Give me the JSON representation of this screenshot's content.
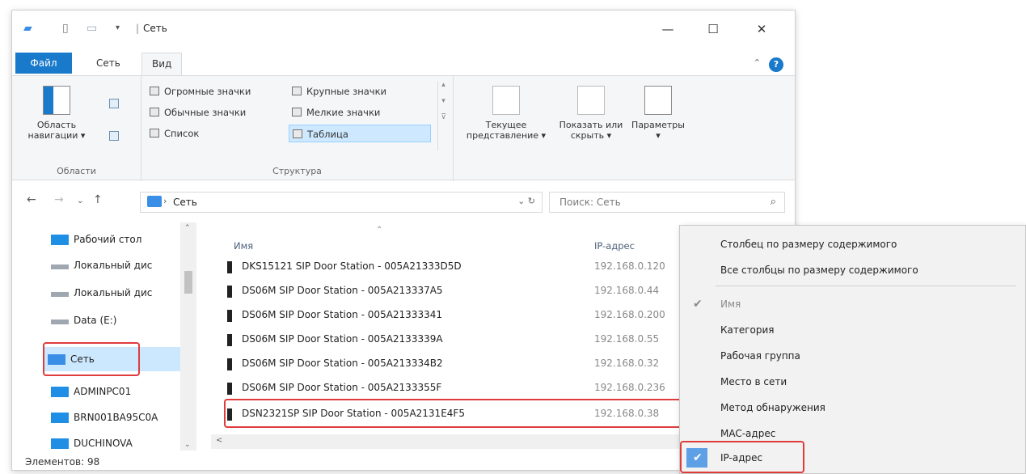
{
  "window": {
    "title": "Сеть",
    "min": "—",
    "max": "☐",
    "close": "✕"
  },
  "ribbon_tabs": {
    "file": "Файл",
    "network": "Сеть",
    "view": "Вид"
  },
  "ribbon": {
    "panes": {
      "nav_pane_label": "Область навигации ▾",
      "group_label": "Области"
    },
    "layout": {
      "items": [
        "Огромные значки",
        "Крупные значки",
        "Обычные значки",
        "Мелкие значки",
        "Список",
        "Таблица"
      ],
      "selected": "Таблица",
      "group_label": "Структура"
    },
    "current_view": {
      "current_label": "Текущее представление ▾",
      "show_hide_label": "Показать или скрыть ▾",
      "options_label": "Параметры ▾"
    }
  },
  "address": {
    "path": "Сеть",
    "search_placeholder": "Поиск: Сеть",
    "refresh_icon": "↻"
  },
  "nav_pane": {
    "items": [
      {
        "label": "Рабочий стол",
        "icon": "desktop-icon"
      },
      {
        "label": "Локальный дис",
        "icon": "drive-icon"
      },
      {
        "label": "Локальный дис",
        "icon": "drive-icon"
      },
      {
        "label": "Data (E:)",
        "icon": "drive-icon"
      },
      {
        "label": "Сеть",
        "icon": "network-icon",
        "selected": true
      },
      {
        "label": "ADMINPC01",
        "icon": "computer-icon"
      },
      {
        "label": "BRN001BA95C0A",
        "icon": "computer-icon"
      },
      {
        "label": "DUCHINOVA",
        "icon": "computer-icon"
      }
    ]
  },
  "file_list": {
    "columns": {
      "name": "Имя",
      "ip": "IP-адрес"
    },
    "rows": [
      {
        "name": "DKS15121 SIP Door Station - 005A21333D5D",
        "ip": "192.168.0.120"
      },
      {
        "name": "DS06M SIP Door Station - 005A213337A5",
        "ip": "192.168.0.44"
      },
      {
        "name": "DS06M SIP Door Station - 005A21333341",
        "ip": "192.168.0.200"
      },
      {
        "name": "DS06M SIP Door Station - 005A2133339A",
        "ip": "192.168.0.55"
      },
      {
        "name": "DS06M SIP Door Station - 005A213334B2",
        "ip": "192.168.0.32"
      },
      {
        "name": "DS06M SIP Door Station - 005A2133355F",
        "ip": "192.168.0.236"
      },
      {
        "name": "DSN2321SP SIP Door Station - 005A2131E4F5",
        "ip": "192.168.0.38"
      }
    ]
  },
  "status": {
    "items_count": "Элементов: 98"
  },
  "context_menu": {
    "items": [
      {
        "label": "Столбец по размеру содержимого",
        "disabled": false,
        "checked": false
      },
      {
        "label": "Все столбцы по размеру содержимого",
        "disabled": false,
        "checked": false
      },
      {
        "label": "Имя",
        "disabled": true,
        "checked": true
      },
      {
        "label": "Категория",
        "disabled": false,
        "checked": false
      },
      {
        "label": "Рабочая группа",
        "disabled": false,
        "checked": false
      },
      {
        "label": "Место в сети",
        "disabled": false,
        "checked": false
      },
      {
        "label": "Метод обнаружения",
        "disabled": false,
        "checked": false
      },
      {
        "label": "MAC-адрес",
        "disabled": false,
        "checked": false
      },
      {
        "label": "IP-адрес",
        "disabled": false,
        "checked": true
      }
    ]
  },
  "colors": {
    "accent": "#1979ca",
    "highlight_box": "#e03c3c",
    "selection": "#cce8ff",
    "menu_check": "#5ea0e6"
  }
}
